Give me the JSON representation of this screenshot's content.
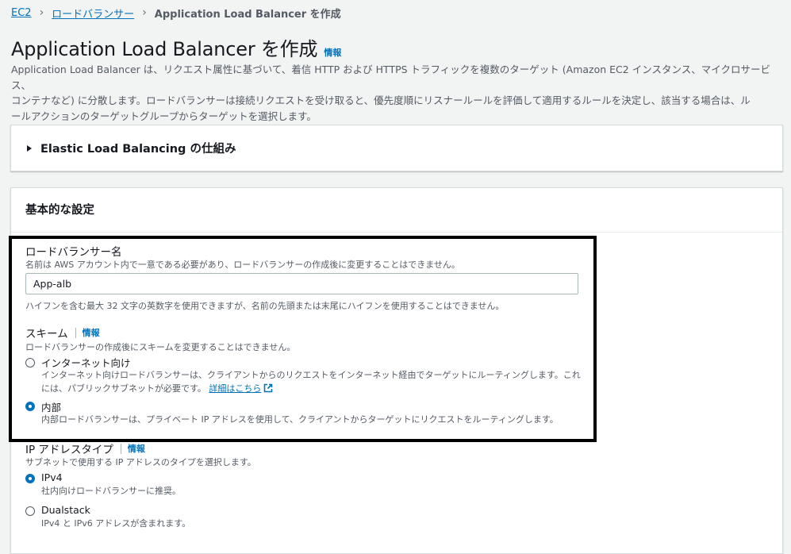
{
  "breadcrumb": {
    "items": [
      "EC2",
      "ロードバランサー"
    ],
    "current": "Application Load Balancer を作成"
  },
  "page": {
    "title": "Application Load Balancer を作成",
    "info": "情報",
    "description_1": "Application Load Balancer は、リクエスト属性に基づいて、着信 HTTP および HTTPS トラフィックを複数のターゲット (Amazon EC2 インスタンス、マイクロサービス、",
    "description_2": "コンテナなど) に分散します。ロードバランサーは接続リクエストを受け取ると、優先度順にリスナールールを評価して適用するルールを決定し、該当する場合は、ル",
    "description_3": "ールアクションのターゲットグループからターゲットを選択します。"
  },
  "elb_section": {
    "label": "Elastic Load Balancing の仕組み"
  },
  "basic": {
    "title": "基本的な設定",
    "name_field": {
      "label": "ロードバランサー名",
      "description": "名前は AWS アカウント内で一意である必要があり、ロードバランサーの作成後に変更することはできません。",
      "value": "App-alb",
      "hint": "ハイフンを含む最大 32 文字の英数字を使用できますが、名前の先頭または末尾にハイフンを使用することはできません。"
    },
    "scheme": {
      "label": "スキーム",
      "info": "情報",
      "description": "ロードバランサーの作成後にスキームを変更することはできません。",
      "internet_label": "インターネット向け",
      "internet_desc_1": "インターネット向けロードバランサーは、クライアントからのリクエストをインターネット経由でターゲットにルーティングします。これ",
      "internet_desc_2": "には、パブリックサブネットが必要です。",
      "internet_link": "詳細はこちら",
      "internal_label": "内部",
      "internal_desc": "内部ロードバランサーは、プライベート IP アドレスを使用して、クライアントからターゲットにリクエストをルーティングします。",
      "selected": "internal"
    },
    "ip_type": {
      "label": "IP アドレスタイプ",
      "info": "情報",
      "description": "サブネットで使用する IP アドレスのタイプを選択します。",
      "ipv4_label": "IPv4",
      "ipv4_desc": "社内向けロードバランサーに推奨。",
      "dualstack_label": "Dualstack",
      "dualstack_desc": "IPv4 と IPv6 アドレスが含まれます。",
      "selected": "ipv4"
    }
  },
  "colors": {
    "link": "#0073bb",
    "text": "#16191f",
    "muted": "#545b64",
    "background": "#f2f3f3",
    "highlight": "#000000"
  }
}
